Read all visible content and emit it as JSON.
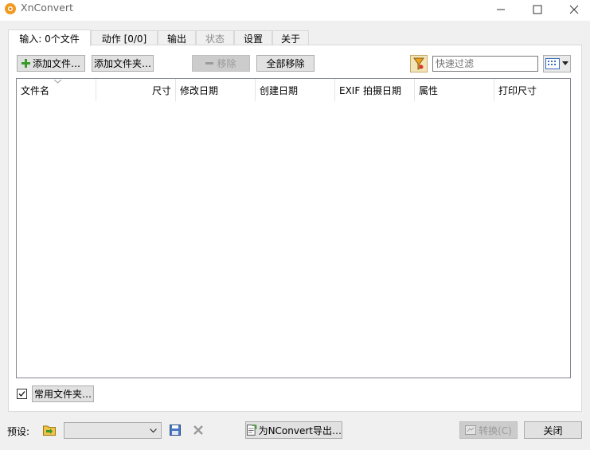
{
  "window": {
    "title": "XnConvert"
  },
  "tabs": [
    {
      "label": "输入: 0个文件"
    },
    {
      "label": "动作 [0/0]"
    },
    {
      "label": "输出"
    },
    {
      "label": "状态"
    },
    {
      "label": "设置"
    },
    {
      "label": "关于"
    }
  ],
  "toolbar": {
    "add_files": "添加文件…",
    "add_folder": "添加文件夹…",
    "remove": "移除",
    "remove_all": "全部移除",
    "filter_placeholder": "快速过滤"
  },
  "list": {
    "columns": [
      "文件名",
      "尺寸",
      "修改日期",
      "创建日期",
      "EXIF 拍摄日期",
      "属性",
      "打印尺寸"
    ],
    "rows": []
  },
  "favorites": {
    "checked": true,
    "label": "常用文件夹…"
  },
  "footer": {
    "preset_label": "预设:",
    "preset_value": "",
    "export_label": "为NConvert导出…",
    "convert_label": "转换(C)",
    "close_label": "关闭"
  }
}
